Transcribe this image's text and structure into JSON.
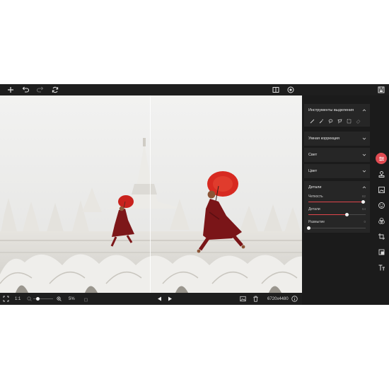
{
  "topbar": {
    "icons": [
      "plus-icon",
      "undo-icon",
      "redo-icon",
      "refresh-icon",
      "compare-icon",
      "eye-icon",
      "save-icon"
    ]
  },
  "panel": {
    "selection_tools": {
      "title": "Инструменты выделения",
      "tools": [
        "brush-icon",
        "magic-wand-icon",
        "lasso-icon",
        "polygon-lasso-icon",
        "rect-select-icon",
        "eraser-icon"
      ]
    },
    "smart_correction": {
      "title": "Умная коррекция"
    },
    "light": {
      "title": "Свет"
    },
    "color": {
      "title": "Цвет"
    },
    "details": {
      "title": "Детали",
      "sliders": [
        {
          "label": "Четкость",
          "value": "82",
          "level": 0.95
        },
        {
          "label": "Детали",
          "value": "64",
          "level": 0.67
        },
        {
          "label": "Размытие",
          "value": "0",
          "level": 0.0
        }
      ]
    }
  },
  "bottombar": {
    "zoom_fit": "1:1",
    "zoom_value": "5%",
    "image_size": "6720x4480"
  },
  "strip": {
    "icons": [
      "adjust-sliders-icon",
      "stamp-icon",
      "image-frame-icon",
      "face-icon",
      "color-mix-icon",
      "crop-icon",
      "layers-icon",
      "text-icon"
    ]
  },
  "colors": {
    "accent": "#e0464c",
    "background": "#1b1b1b",
    "panel_section": "#262626"
  }
}
